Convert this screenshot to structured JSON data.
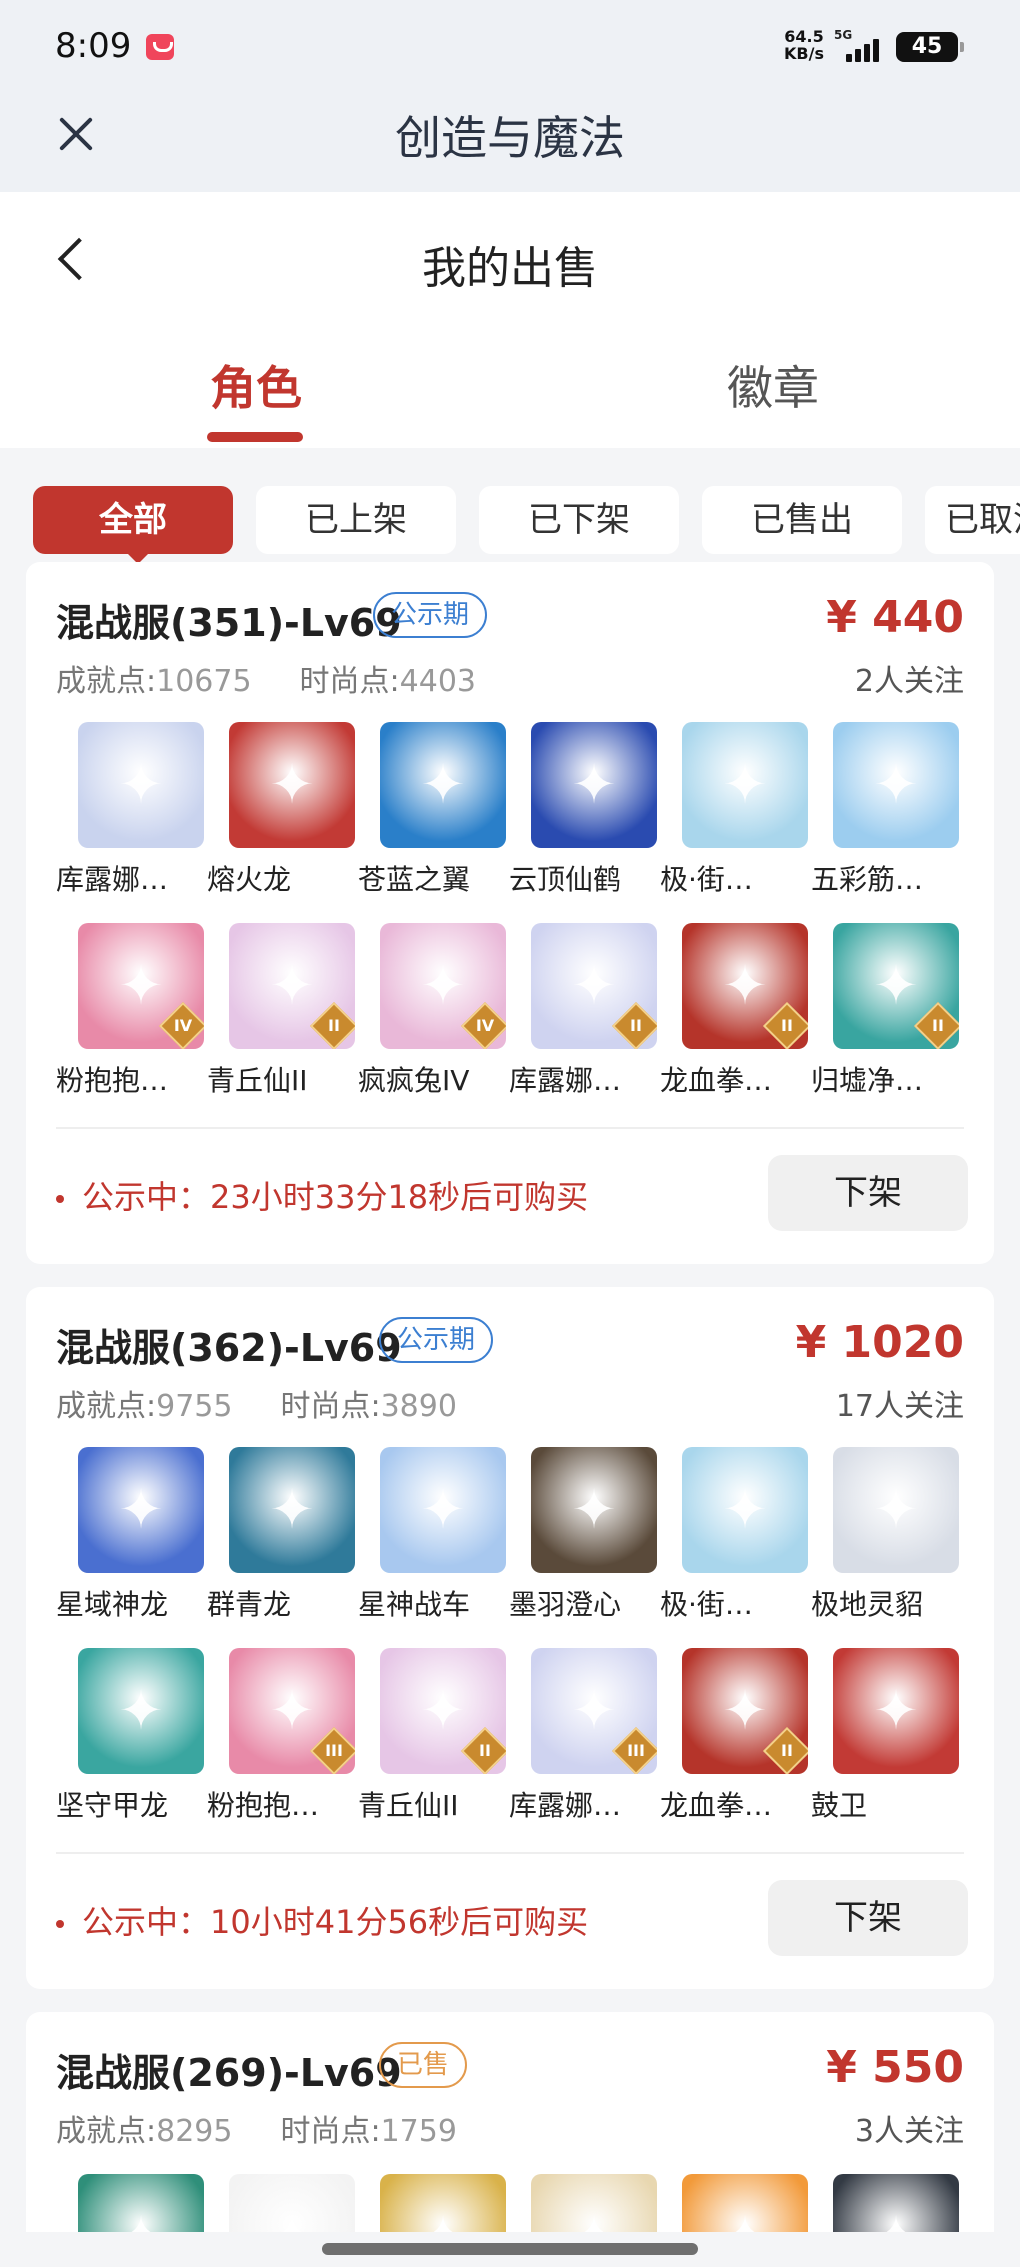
{
  "status_bar": {
    "time": "8:09",
    "speed_value": "64.5",
    "speed_unit": "KB/s",
    "network": "5G",
    "battery": "45"
  },
  "app_bar": {
    "title": "创造与魔法"
  },
  "page": {
    "title": "我的出售"
  },
  "tabs": [
    {
      "label": "角色",
      "active": true
    },
    {
      "label": "徽章",
      "active": false
    }
  ],
  "filters": [
    {
      "label": "全部",
      "active": true
    },
    {
      "label": "已上架"
    },
    {
      "label": "已下架"
    },
    {
      "label": "已售出"
    },
    {
      "label": "已取消"
    }
  ],
  "listings": [
    {
      "title": "混战服(351)-Lv69",
      "badge": "公示期",
      "achievement_label": "成就点:",
      "achievement_value": "10675",
      "fashion_label": "时尚点:",
      "fashion_value": "4403",
      "price": "¥ 440",
      "followers": "2人关注",
      "items": [
        {
          "name": "库露娜…",
          "color": "#c9d3ee"
        },
        {
          "name": "熔火龙",
          "color": "#c23a35"
        },
        {
          "name": "苍蓝之翼",
          "color": "#2a7fc9"
        },
        {
          "name": "云顶仙鹤",
          "color": "#2a4bb0"
        },
        {
          "name": "极·街…",
          "color": "#a9d6ec"
        },
        {
          "name": "五彩筋…",
          "color": "#9ccdef"
        },
        {
          "name": "粉抱抱…",
          "color": "#e88aa8",
          "rank": "IV"
        },
        {
          "name": "青丘仙II",
          "color": "#e6c6e6",
          "rank": "II"
        },
        {
          "name": "疯疯兔IV",
          "color": "#e9b8d8",
          "rank": "IV"
        },
        {
          "name": "库露娜…",
          "color": "#cfd3f0",
          "rank": "II"
        },
        {
          "name": "龙血拳…",
          "color": "#b5342a",
          "rank": "II"
        },
        {
          "name": "归墟净…",
          "color": "#39a5a0",
          "rank": "II"
        }
      ],
      "notice": "公示中：23小时33分18秒后可购买",
      "action": "下架"
    },
    {
      "title": "混战服(362)-Lv69",
      "badge": "公示期",
      "achievement_label": "成就点:",
      "achievement_value": "9755",
      "fashion_label": "时尚点:",
      "fashion_value": "3890",
      "price": "¥ 1020",
      "followers": "17人关注",
      "items": [
        {
          "name": "星域神龙",
          "color": "#4a6fd0"
        },
        {
          "name": "群青龙",
          "color": "#2f7a9a"
        },
        {
          "name": "星神战车",
          "color": "#a8c8ef"
        },
        {
          "name": "墨羽澄心",
          "color": "#5a4a3a"
        },
        {
          "name": "极·街…",
          "color": "#a9d6ec"
        },
        {
          "name": "极地灵貂",
          "color": "#d8dde6"
        },
        {
          "name": "坚守甲龙",
          "color": "#3aa6a0"
        },
        {
          "name": "粉抱抱…",
          "color": "#e88aa8",
          "rank": "III"
        },
        {
          "name": "青丘仙II",
          "color": "#e6c6e6",
          "rank": "II"
        },
        {
          "name": "库露娜…",
          "color": "#cfd3f0",
          "rank": "III"
        },
        {
          "name": "龙血拳…",
          "color": "#b5342a",
          "rank": "II"
        },
        {
          "name": "鼓卫",
          "color": "#c23a35"
        }
      ],
      "notice": "公示中：10小时41分56秒后可购买",
      "action": "下架"
    },
    {
      "title": "混战服(269)-Lv69",
      "badge": "已售",
      "achievement_label": "成就点:",
      "achievement_value": "8295",
      "fashion_label": "时尚点:",
      "fashion_value": "1759",
      "price": "¥ 550",
      "followers": "3人关注",
      "items": [
        {
          "name": "",
          "color": "#2f8f7a"
        },
        {
          "name": "",
          "color": "#f3f3f3"
        },
        {
          "name": "",
          "color": "#d9b24a"
        },
        {
          "name": "",
          "color": "#e8d7b0"
        },
        {
          "name": "",
          "color": "#f29a3a"
        },
        {
          "name": "",
          "color": "#333a44"
        }
      ]
    }
  ]
}
